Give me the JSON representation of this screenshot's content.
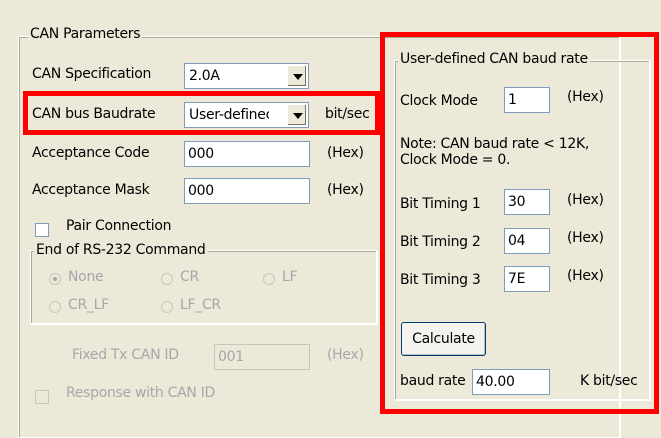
{
  "can_parameters": {
    "title": "CAN Parameters",
    "spec_label": "CAN Specification",
    "spec_value": "2.0A",
    "baud_label": "CAN bus Baudrate",
    "baud_value": "User-definec",
    "baud_unit": "bit/sec",
    "acc_code_label": "Acceptance Code",
    "acc_code_value": "000",
    "acc_code_unit": "(Hex)",
    "acc_mask_label": "Acceptance Mask",
    "acc_mask_value": "000",
    "acc_mask_unit": "(Hex)",
    "pair_label": "Pair Connection",
    "end_group_title": "End of RS-232 Command",
    "end_options": [
      "None",
      "CR",
      "LF",
      "CR_LF",
      "LF_CR"
    ],
    "end_selected": "None",
    "fixed_tx_label": "Fixed Tx CAN ID",
    "fixed_tx_value": "001",
    "fixed_tx_unit": "(Hex)",
    "response_label": "Response with CAN ID"
  },
  "user_baud": {
    "title": "User-defined CAN baud rate",
    "clock_label": "Clock Mode",
    "clock_value": "1",
    "clock_unit": "(Hex)",
    "note": "Note: CAN baud rate < 12K,",
    "note2": "Clock Mode = 0.",
    "bt1_label": "Bit Timing 1",
    "bt1_value": "30",
    "bt1_unit": "(Hex)",
    "bt2_label": "Bit Timing 2",
    "bt2_value": "04",
    "bt2_unit": "(Hex)",
    "bt3_label": "Bit Timing 3",
    "bt3_value": "7E",
    "bt3_unit": "(Hex)",
    "calc_button": "Calculate",
    "baud_rate_label": "baud rate",
    "baud_rate_value": "40.00",
    "baud_rate_unit": "K bit/sec"
  },
  "colors": {
    "highlight": "#ff0000",
    "window_bg": "#ece9d8",
    "field_border": "#7f9db9"
  }
}
